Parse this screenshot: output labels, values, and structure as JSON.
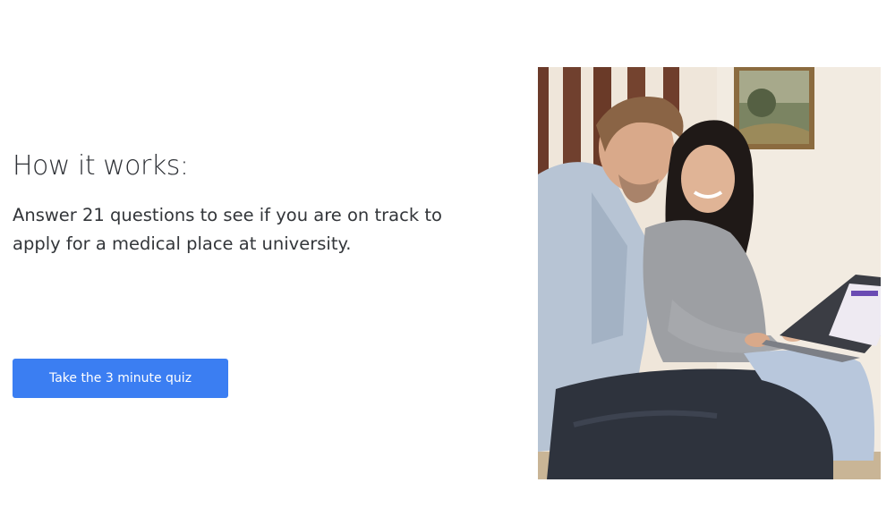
{
  "section": {
    "heading": "How it works:",
    "description": "Answer 21 questions to see if you are on track to apply for a medical place at university.",
    "cta_label": "Take the 3 minute quiz"
  },
  "colors": {
    "cta_background": "#3b7ef2",
    "heading_text": "#2e3136"
  },
  "photo": {
    "icon": "photo-couple-laptop"
  }
}
